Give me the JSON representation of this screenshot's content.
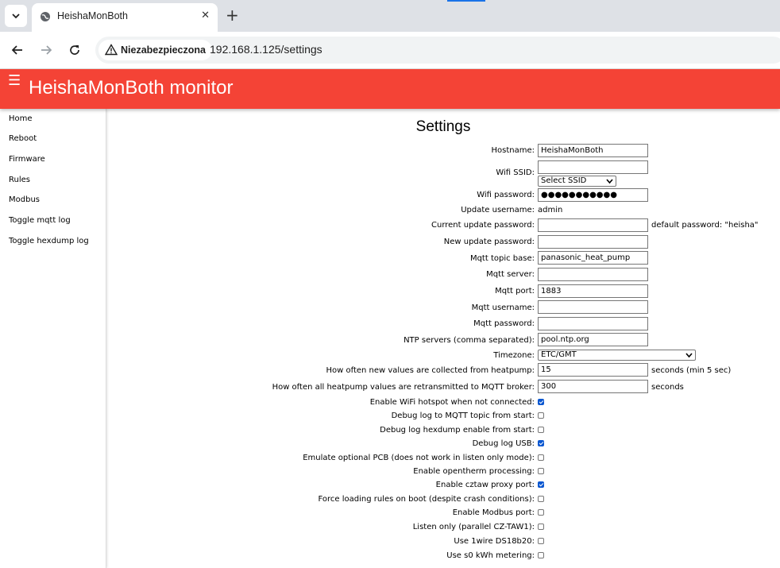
{
  "browser": {
    "tab_title": "HeishaMonBoth",
    "security_label": "Niezabezpieczona",
    "url": "192.168.1.125/settings"
  },
  "app": {
    "title": "HeishaMonBoth monitor",
    "menu_icon": "☰",
    "header_color": "#f44336"
  },
  "sidebar": {
    "items": [
      {
        "label": "Home"
      },
      {
        "label": "Reboot"
      },
      {
        "label": "Firmware"
      },
      {
        "label": "Rules"
      },
      {
        "label": "Modbus"
      },
      {
        "label": "Toggle mqtt log"
      },
      {
        "label": "Toggle hexdump log"
      }
    ]
  },
  "settings": {
    "heading": "Settings",
    "hostname": {
      "label": "Hostname:",
      "value": "HeishaMonBoth"
    },
    "wifi_ssid": {
      "label": "Wifi SSID:",
      "value": "",
      "select_value": "Select SSID"
    },
    "wifi_password": {
      "label": "Wifi password:",
      "value": "●●●●●●●●●●●"
    },
    "update_username": {
      "label": "Update username:",
      "value": "admin"
    },
    "current_update_password": {
      "label": "Current update password:",
      "value": "",
      "note": "default password: \"heisha\""
    },
    "new_update_password": {
      "label": "New update password:",
      "value": ""
    },
    "mqtt_topic_base": {
      "label": "Mqtt topic base:",
      "value": "panasonic_heat_pump"
    },
    "mqtt_server": {
      "label": "Mqtt server:",
      "value": ""
    },
    "mqtt_port": {
      "label": "Mqtt port:",
      "value": "1883"
    },
    "mqtt_username": {
      "label": "Mqtt username:",
      "value": ""
    },
    "mqtt_password": {
      "label": "Mqtt password:",
      "value": ""
    },
    "ntp_servers": {
      "label": "NTP servers (comma separated):",
      "value": "pool.ntp.org"
    },
    "timezone": {
      "label": "Timezone:",
      "value": "ETC/GMT"
    },
    "collect_interval": {
      "label": "How often new values are collected from heatpump:",
      "value": "15",
      "note": "seconds (min 5 sec)"
    },
    "retransmit_interval": {
      "label": "How often all heatpump values are retransmitted to MQTT broker:",
      "value": "300",
      "note": "seconds"
    },
    "checkboxes": [
      {
        "label": "Enable WiFi hotspot when not connected:",
        "checked": true
      },
      {
        "label": "Debug log to MQTT topic from start:",
        "checked": false
      },
      {
        "label": "Debug log hexdump enable from start:",
        "checked": false
      },
      {
        "label": "Debug log USB:",
        "checked": true
      },
      {
        "label": "Emulate optional PCB (does not work in listen only mode):",
        "checked": false
      },
      {
        "label": "Enable opentherm processing:",
        "checked": false
      },
      {
        "label": "Enable cztaw proxy port:",
        "checked": true
      },
      {
        "label": "Force loading rules on boot (despite crash conditions):",
        "checked": false
      },
      {
        "label": "Enable Modbus port:",
        "checked": false
      },
      {
        "label": "Listen only (parallel CZ-TAW1):",
        "checked": false
      },
      {
        "label": "Use 1wire DS18b20:",
        "checked": false
      },
      {
        "label": "Use s0 kWh metering:",
        "checked": false
      }
    ]
  }
}
